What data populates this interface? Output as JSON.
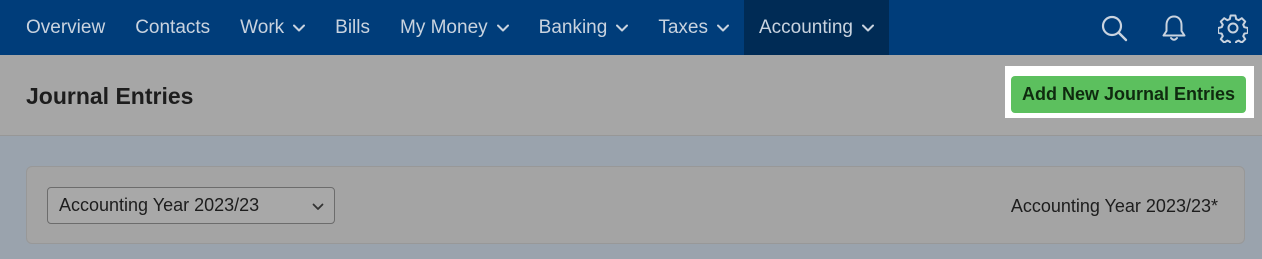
{
  "nav": {
    "items": [
      {
        "label": "Overview",
        "has_dropdown": false,
        "active": false
      },
      {
        "label": "Contacts",
        "has_dropdown": false,
        "active": false
      },
      {
        "label": "Work",
        "has_dropdown": true,
        "active": false
      },
      {
        "label": "Bills",
        "has_dropdown": false,
        "active": false
      },
      {
        "label": "My Money",
        "has_dropdown": true,
        "active": false
      },
      {
        "label": "Banking",
        "has_dropdown": true,
        "active": false
      },
      {
        "label": "Taxes",
        "has_dropdown": true,
        "active": false
      },
      {
        "label": "Accounting",
        "has_dropdown": true,
        "active": true
      }
    ],
    "icons": [
      "search-icon",
      "bell-icon",
      "gear-icon"
    ]
  },
  "header": {
    "title": "Journal Entries",
    "add_button_label": "Add New Journal Entries"
  },
  "filter": {
    "selected_year": "Accounting Year 2023/23",
    "year_label": "Accounting Year 2023/23*"
  },
  "colors": {
    "nav_bg": "#003d7a",
    "nav_active_bg": "#002b55",
    "button_green": "#5cc05e"
  }
}
